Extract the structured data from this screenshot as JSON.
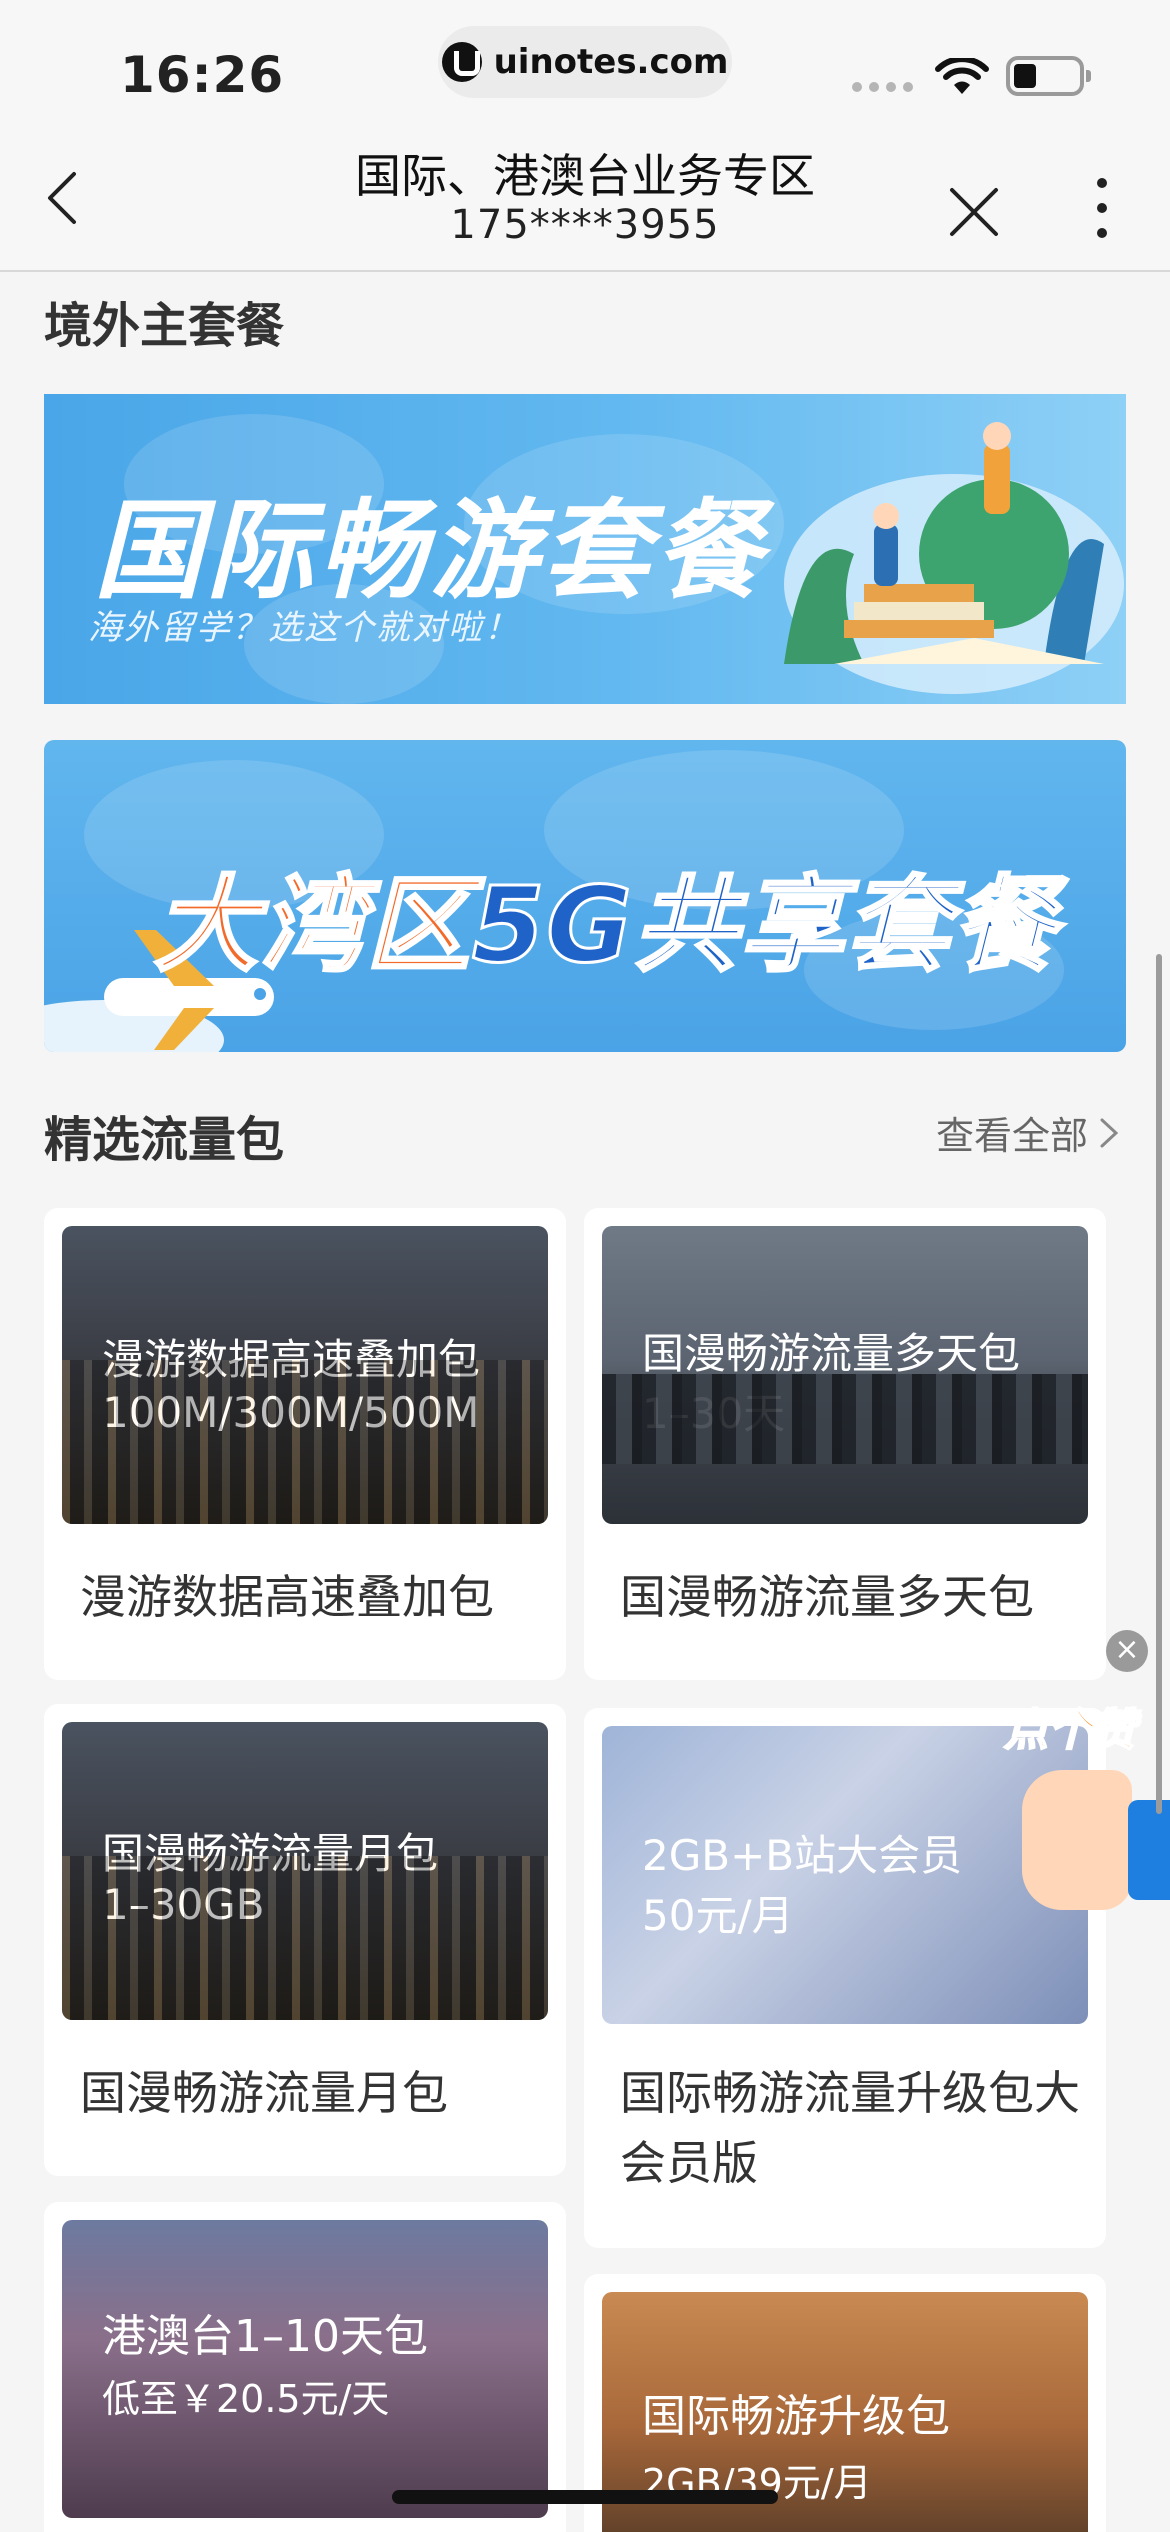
{
  "status": {
    "time": "16:26",
    "url": "uinotes.com"
  },
  "nav": {
    "title": "国际、港澳台业务专区",
    "subtitle": "175****3955"
  },
  "section_main": {
    "title": "境外主套餐"
  },
  "banners": [
    {
      "title": "国际畅游套餐",
      "subtitle": "海外留学？选这个就对啦！"
    },
    {
      "title_orange": "大湾区",
      "title_blue": "5G共享套餐"
    }
  ],
  "section_packs": {
    "title": "精选流量包",
    "view_all": "查看全部"
  },
  "cards": [
    {
      "thumb_line1": "漫游数据高速叠加包",
      "thumb_line2": "100M/300M/500M",
      "label": "漫游数据高速叠加包"
    },
    {
      "thumb_line1": "国漫畅游流量多天包",
      "thumb_line2": "1–30天",
      "label": "国漫畅游流量多天包"
    },
    {
      "thumb_line1": "国漫畅游流量月包",
      "thumb_line2": "1–30GB",
      "label": "国漫畅游流量月包"
    },
    {
      "thumb_line1": "2GB+B站大会员",
      "thumb_line2": "50元/月",
      "label": "国际畅游流量升级包大会员版"
    },
    {
      "thumb_line1": "港澳台1–10天包",
      "thumb_line2": "低至￥20.5元/天"
    },
    {
      "thumb_line1": "国际畅游升级包",
      "thumb_line2": "2GB/39元/月"
    }
  ],
  "floating": {
    "like_text": "点个赞",
    "close_symbol": "×",
    "like_icon": "thumbs-up-icon"
  },
  "colors": {
    "accent_orange": "#f26b2a",
    "accent_blue": "#1f63c9",
    "banner_blue": "#4aa6e8"
  }
}
